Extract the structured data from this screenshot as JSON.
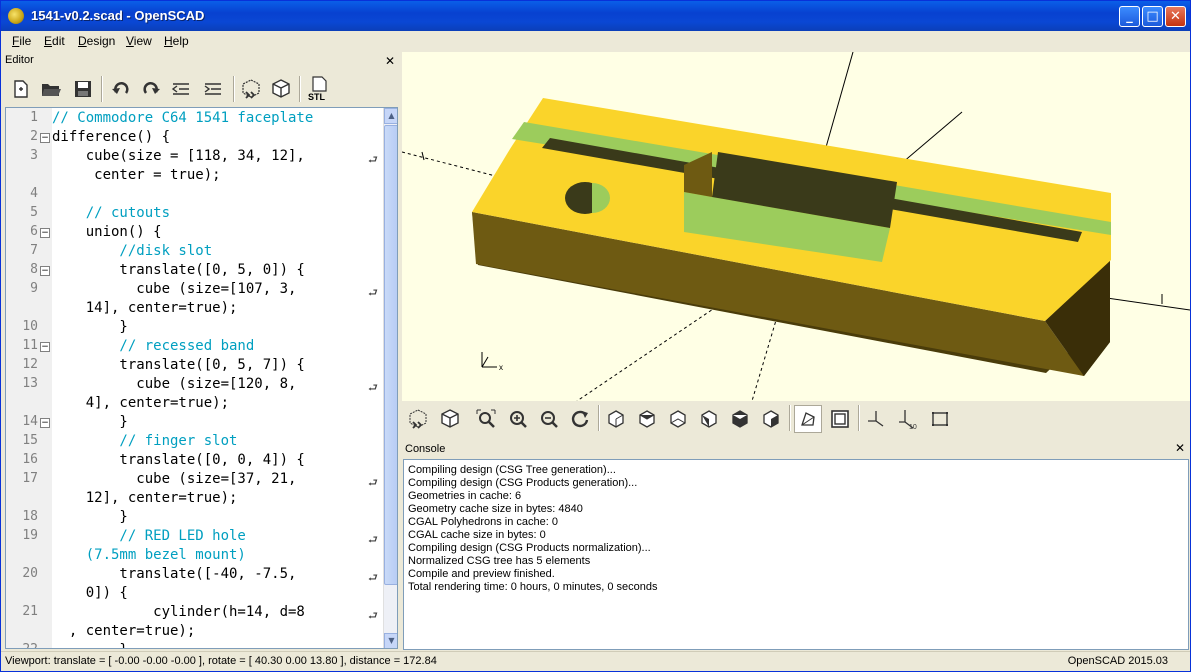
{
  "window": {
    "title": "1541-v0.2.scad - OpenSCAD",
    "minimize": "_",
    "maximize": "□",
    "close": "✕"
  },
  "menu": {
    "items": [
      {
        "label": "File",
        "u": "F",
        "rest": "ile"
      },
      {
        "label": "Edit",
        "u": "E",
        "rest": "dit"
      },
      {
        "label": "Design",
        "u": "D",
        "rest": "esign"
      },
      {
        "label": "View",
        "u": "V",
        "rest": "iew"
      },
      {
        "label": "Help",
        "u": "H",
        "rest": "elp"
      }
    ]
  },
  "editor": {
    "title": "Editor",
    "close": "✕",
    "toolbar": [
      "new-file-icon",
      "open-file-icon",
      "save-icon",
      "undo-icon",
      "redo-icon",
      "unindent-icon",
      "indent-icon",
      "preview-icon",
      "render-icon",
      "export-stl-icon"
    ],
    "stl_label": "STL",
    "line_numbers": [
      "1",
      "2",
      "3",
      "",
      "4",
      "5",
      "6",
      "7",
      "8",
      "9",
      "",
      "10",
      "11",
      "12",
      "13",
      "",
      "14",
      "15",
      "16",
      "17",
      "",
      "18",
      "19",
      "",
      "20",
      "",
      "21",
      "",
      "22"
    ],
    "lines": [
      {
        "cls": "cm",
        "text": "// Commodore C64 1541 faceplate"
      },
      {
        "cls": "",
        "text": "difference() {"
      },
      {
        "cls": "",
        "text": "    cube(size = [118, 34, 12],"
      },
      {
        "cls": "",
        "text": "     center = true);"
      },
      {
        "cls": "",
        "text": ""
      },
      {
        "cls": "cm",
        "text": "    // cutouts"
      },
      {
        "cls": "",
        "text": "    union() {"
      },
      {
        "cls": "cm",
        "text": "        //disk slot"
      },
      {
        "cls": "",
        "text": "        translate([0, 5, 0]) {"
      },
      {
        "cls": "",
        "text": "          cube (size=[107, 3,"
      },
      {
        "cls": "",
        "text": "    14], center=true);"
      },
      {
        "cls": "",
        "text": "        }"
      },
      {
        "cls": "cm",
        "text": "        // recessed band"
      },
      {
        "cls": "",
        "text": "        translate([0, 5, 7]) {"
      },
      {
        "cls": "",
        "text": "          cube (size=[120, 8,"
      },
      {
        "cls": "",
        "text": "    4], center=true);"
      },
      {
        "cls": "",
        "text": "        }"
      },
      {
        "cls": "cm",
        "text": "        // finger slot"
      },
      {
        "cls": "",
        "text": "        translate([0, 0, 4]) {"
      },
      {
        "cls": "",
        "text": "          cube (size=[37, 21,"
      },
      {
        "cls": "",
        "text": "    12], center=true);"
      },
      {
        "cls": "",
        "text": "        }"
      },
      {
        "cls": "cm",
        "text": "        // RED LED hole"
      },
      {
        "cls": "cm",
        "text": "    (7.5mm bezel mount)"
      },
      {
        "cls": "",
        "text": "        translate([-40, -7.5,"
      },
      {
        "cls": "",
        "text": "    0]) {"
      },
      {
        "cls": "",
        "text": "            cylinder(h=14, d=8"
      },
      {
        "cls": "",
        "text": "  , center=true);"
      },
      {
        "cls": "",
        "text": "        }"
      }
    ]
  },
  "viewport": {
    "axis_label": "x"
  },
  "view_toolbar": [
    "preview-icon",
    "render-icon",
    "view-all-icon",
    "zoom-in-icon",
    "zoom-out-icon",
    "reset-view-icon",
    "view-right-icon",
    "view-top-icon",
    "view-bottom-icon",
    "view-left-icon",
    "view-front-icon",
    "view-back-icon",
    "perspective-icon",
    "orthogonal-icon",
    "show-axes-icon",
    "show-scale-icon",
    "show-edges-icon"
  ],
  "console": {
    "title": "Console",
    "close": "✕",
    "lines": [
      "Compiling design (CSG Tree generation)...",
      "Compiling design (CSG Products generation)...",
      "Geometries in cache: 6",
      "Geometry cache size in bytes: 4840",
      "CGAL Polyhedrons in cache: 0",
      "CGAL cache size in bytes: 0",
      "Compiling design (CSG Products normalization)...",
      "Normalized CSG tree has 5 elements",
      "Compile and preview finished.",
      "Total rendering time: 0 hours, 0 minutes, 0 seconds"
    ]
  },
  "status": {
    "viewport": "Viewport: translate = [ -0.00 -0.00 -0.00 ], rotate = [ 40.30 0.00 13.80 ], distance = 172.84",
    "version": "OpenSCAD 2015.03"
  },
  "colors": {
    "model_top": "#fad42a",
    "model_side": "#4a3c0a",
    "model_front": "#6e5a12",
    "cutout": "#9ccc5c",
    "cutout_dark": "#3a3a1a",
    "viewport_bg": "#ffffe5"
  }
}
